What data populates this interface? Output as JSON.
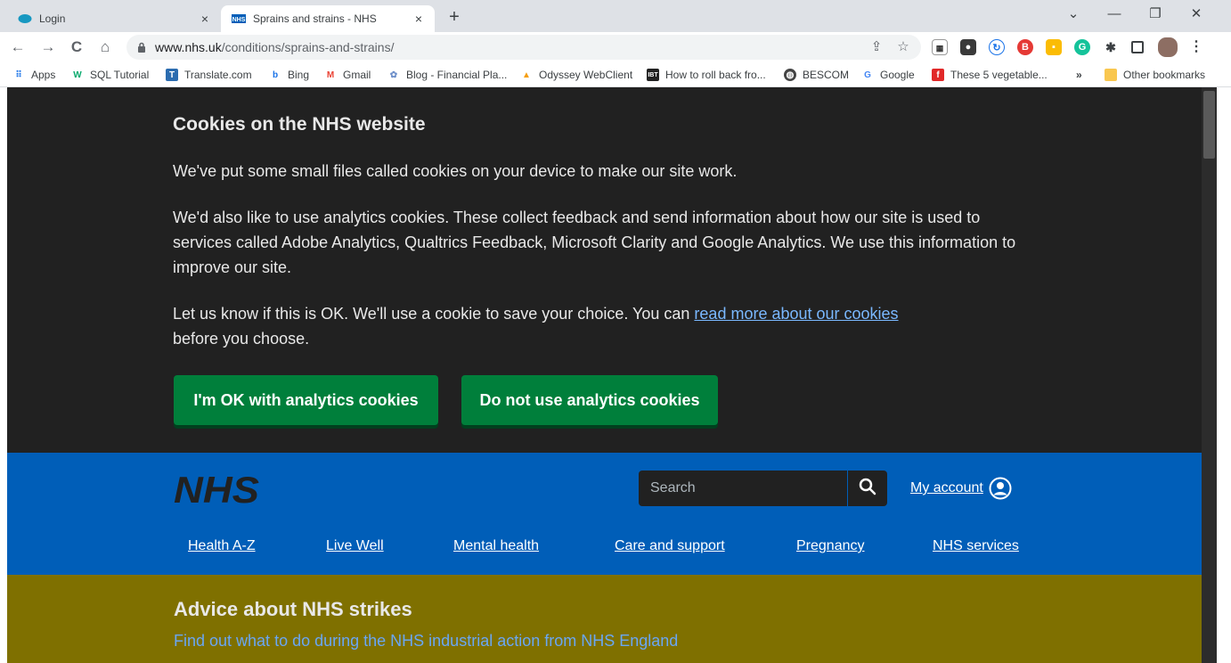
{
  "browser": {
    "tabs": [
      {
        "title": "Login",
        "close": "×"
      },
      {
        "title": "Sprains and strains - NHS",
        "close": "×"
      }
    ],
    "new_tab": "+",
    "window_controls": {
      "minimize": "—",
      "restore": "❐",
      "close": "✕",
      "menu": "⌄"
    },
    "nav": {
      "back": "←",
      "forward": "→",
      "reload": "C",
      "home": "⌂"
    },
    "url_host": "www.nhs.uk",
    "url_path": "/conditions/sprains-and-strains/",
    "bookmarks": [
      {
        "label": "Apps",
        "icon": "apps-grid-icon"
      },
      {
        "label": "SQL Tutorial",
        "icon": "w3schools-icon"
      },
      {
        "label": "Translate.com",
        "icon": "translate-icon"
      },
      {
        "label": "Bing",
        "icon": "bing-icon"
      },
      {
        "label": "Gmail",
        "icon": "gmail-icon"
      },
      {
        "label": "Blog - Financial Pla...",
        "icon": "blog-icon"
      },
      {
        "label": "Odyssey WebClient",
        "icon": "odyssey-icon"
      },
      {
        "label": "How to roll back fro...",
        "icon": "ibt-icon"
      },
      {
        "label": "BESCOM",
        "icon": "globe-icon"
      },
      {
        "label": "Google",
        "icon": "google-icon"
      },
      {
        "label": "These 5 vegetable...",
        "icon": "flipboard-icon"
      }
    ],
    "bookmarks_overflow": "»",
    "other_bookmarks": "Other bookmarks"
  },
  "cookie_banner": {
    "title": "Cookies on the NHS website",
    "p1": "We've put some small files called cookies on your device to make our site work.",
    "p2": "We'd also like to use analytics cookies. These collect feedback and send information about how our site is used to services called Adobe Analytics, Qualtrics Feedback, Microsoft Clarity and Google Analytics. We use this information to improve our site.",
    "p3_before": "Let us know if this is OK. We'll use a cookie to save your choice. You can ",
    "p3_link": "read more about our cookies",
    "p3_after": "before you choose.",
    "accept_label": "I'm OK with analytics cookies",
    "reject_label": "Do not use analytics cookies"
  },
  "header": {
    "logo_text": "NHS",
    "search_placeholder": "Search",
    "account_label": "My account",
    "nav": [
      "Health A-Z",
      "Live Well",
      "Mental health",
      "Care and support",
      "Pregnancy",
      "NHS services"
    ]
  },
  "strikes": {
    "title": "Advice about NHS strikes",
    "link": "Find out what to do during the NHS industrial action from NHS England"
  },
  "colors": {
    "nhs_blue": "#005eb8",
    "nhs_green": "#007f3b",
    "cookie_bg": "#212121",
    "strikes_bg": "#7f7000"
  }
}
